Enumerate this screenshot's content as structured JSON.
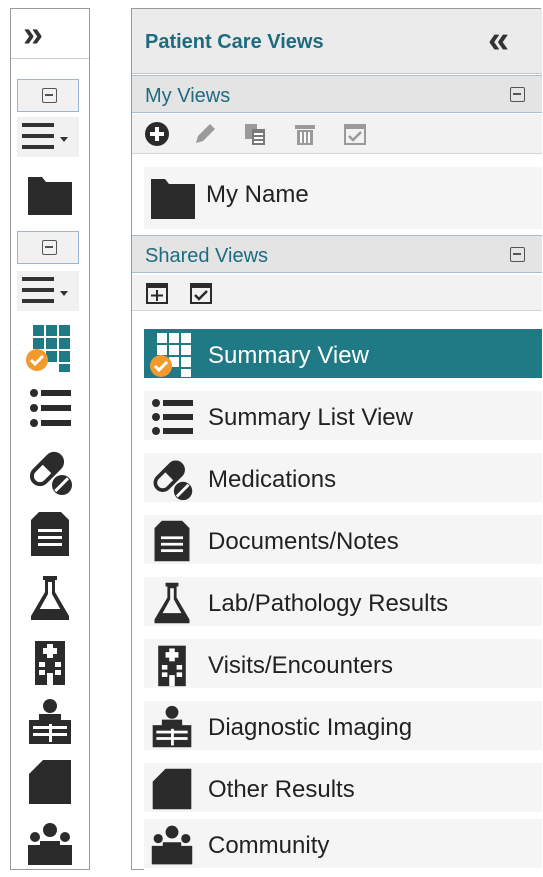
{
  "panel": {
    "title": "Patient Care Views",
    "my_views": {
      "label": "My Views",
      "toolbar_icons": [
        "add-icon",
        "edit-icon",
        "copy-icon",
        "delete-icon",
        "checklist-icon"
      ],
      "items": [
        {
          "label": "My Name",
          "icon": "folder-icon"
        }
      ]
    },
    "shared_views": {
      "label": "Shared Views",
      "toolbar_icons": [
        "add-view-icon",
        "checklist-icon"
      ],
      "items": [
        {
          "label": "Summary View",
          "icon": "summary-grid-icon",
          "selected": true
        },
        {
          "label": "Summary List View",
          "icon": "list-icon"
        },
        {
          "label": "Medications",
          "icon": "pills-icon"
        },
        {
          "label": "Documents/Notes",
          "icon": "document-icon"
        },
        {
          "label": "Lab/Pathology Results",
          "icon": "flask-icon"
        },
        {
          "label": "Visits/Encounters",
          "icon": "hospital-icon"
        },
        {
          "label": "Diagnostic Imaging",
          "icon": "imaging-icon"
        },
        {
          "label": "Other Results",
          "icon": "page-icon"
        },
        {
          "label": "Community",
          "icon": "community-icon"
        }
      ]
    }
  },
  "colors": {
    "accent": "#1f7a85",
    "badge": "#f29a2e",
    "header_text": "#1e6b80",
    "icon": "#2b2b2b"
  }
}
